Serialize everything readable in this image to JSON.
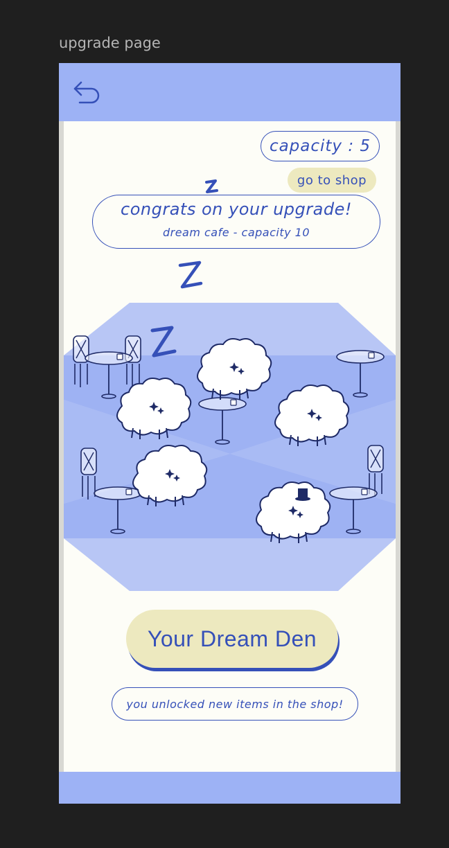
{
  "frame": {
    "label": "upgrade page"
  },
  "header": {
    "back_icon": "back-arrow-icon"
  },
  "capacity": {
    "label": "capacity : 5"
  },
  "shop": {
    "label": "go to shop"
  },
  "congrats": {
    "title": "congrats on your upgrade!",
    "subtitle": "dream cafe - capacity 10"
  },
  "main": {
    "den_button": "Your Dream Den",
    "unlock_message": "you unlocked new items in the shop!"
  },
  "colors": {
    "accent": "#3550b8",
    "bar": "#9db2f5",
    "button": "#ede9bf",
    "background": "#fdfdf7",
    "floor_light": "#b8c6f5",
    "floor_mid": "#9eb2f3"
  }
}
